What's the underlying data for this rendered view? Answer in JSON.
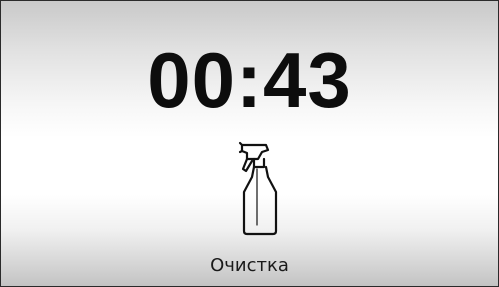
{
  "display": {
    "timer": "00:43",
    "mode_label": "Очистка",
    "mode_icon": "spray-bottle-icon"
  },
  "colors": {
    "text": "#111111",
    "frame": "#2a2a2a"
  }
}
